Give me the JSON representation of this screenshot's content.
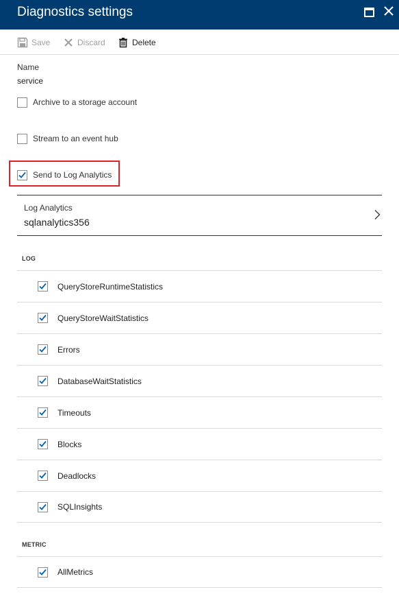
{
  "window": {
    "title": "Diagnostics settings"
  },
  "toolbar": {
    "save_label": "Save",
    "discard_label": "Discard",
    "delete_label": "Delete"
  },
  "name_field": {
    "label": "Name",
    "value": "service"
  },
  "options": {
    "archive": {
      "label": "Archive to a storage account",
      "checked": false
    },
    "stream": {
      "label": "Stream to an event hub",
      "checked": false
    },
    "send": {
      "label": "Send to Log Analytics",
      "checked": true
    }
  },
  "log_analytics": {
    "label": "Log Analytics",
    "value": "sqlanalytics356"
  },
  "log_section": {
    "heading": "LOG",
    "items": [
      {
        "label": "QueryStoreRuntimeStatistics",
        "checked": true
      },
      {
        "label": "QueryStoreWaitStatistics",
        "checked": true
      },
      {
        "label": "Errors",
        "checked": true
      },
      {
        "label": "DatabaseWaitStatistics",
        "checked": true
      },
      {
        "label": "Timeouts",
        "checked": true
      },
      {
        "label": "Blocks",
        "checked": true
      },
      {
        "label": "Deadlocks",
        "checked": true
      },
      {
        "label": "SQLInsights",
        "checked": true
      }
    ]
  },
  "metric_section": {
    "heading": "METRIC",
    "items": [
      {
        "label": "AllMetrics",
        "checked": true
      }
    ]
  },
  "colors": {
    "titlebar": "#003c70",
    "check": "#0063b1",
    "highlight": "#e0202a"
  }
}
